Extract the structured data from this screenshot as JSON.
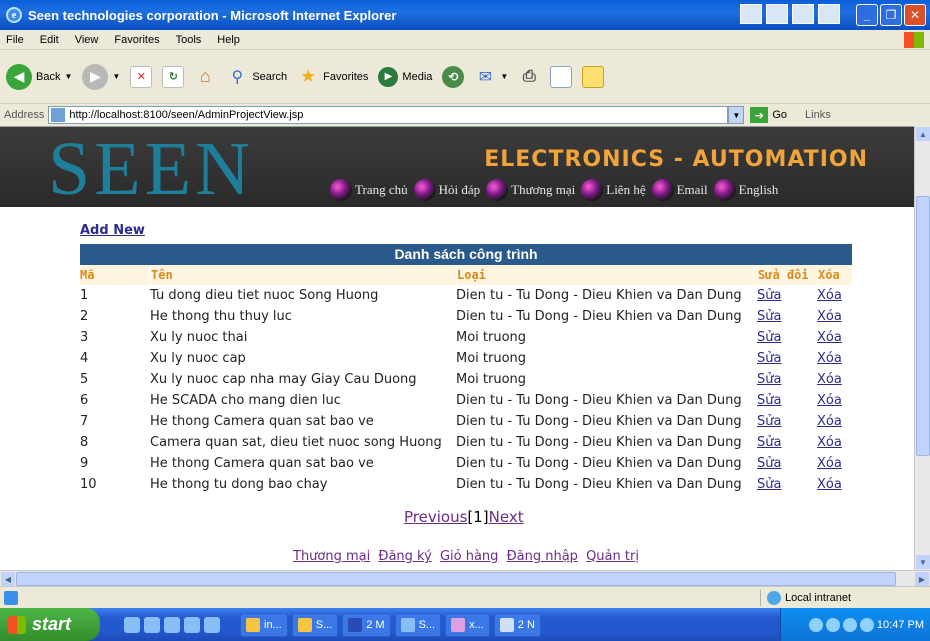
{
  "window": {
    "title": "Seen technologies corporation - Microsoft Internet Explorer"
  },
  "menu": [
    "File",
    "Edit",
    "View",
    "Favorites",
    "Tools",
    "Help"
  ],
  "toolbar": {
    "back": "Back",
    "search": "Search",
    "favorites": "Favorites",
    "media": "Media"
  },
  "address": {
    "label": "Address",
    "url": "http://localhost:8100/seen/AdminProjectView.jsp",
    "go": "Go",
    "links": "Links"
  },
  "banner": {
    "logo": "SEEN",
    "slogan": "ELECTRONICS - AUTOMATION",
    "nav": [
      "Trang chủ",
      "Hỏi đáp",
      "Thương mại",
      "Liên hệ",
      "Email",
      "English"
    ]
  },
  "content": {
    "add_new": "Add New",
    "table_title": "Danh sách công trình",
    "headers": {
      "id": "Mã",
      "name": "Tên",
      "type": "Loại",
      "edit": "Sửa đổi",
      "delete": "Xóa"
    },
    "rows": [
      {
        "id": "1",
        "name": "Tu dong dieu tiet nuoc Song Huong",
        "type": "Dien tu - Tu Dong - Dieu Khien va Dan Dung",
        "edit": "Sửa",
        "delete": "Xóa"
      },
      {
        "id": "2",
        "name": "He thong thu thuy luc",
        "type": "Dien tu - Tu Dong - Dieu Khien va Dan Dung",
        "edit": "Sửa",
        "delete": "Xóa"
      },
      {
        "id": "3",
        "name": "Xu ly nuoc thai",
        "type": "Moi truong",
        "edit": "Sửa",
        "delete": "Xóa"
      },
      {
        "id": "4",
        "name": "Xu ly nuoc cap",
        "type": "Moi truong",
        "edit": "Sửa",
        "delete": "Xóa"
      },
      {
        "id": "5",
        "name": "Xu ly nuoc cap nha may Giay Cau Duong",
        "type": "Moi truong",
        "edit": "Sửa",
        "delete": "Xóa"
      },
      {
        "id": "6",
        "name": "He SCADA cho mang dien luc",
        "type": "Dien tu - Tu Dong - Dieu Khien va Dan Dung",
        "edit": "Sửa",
        "delete": "Xóa"
      },
      {
        "id": "7",
        "name": "He thong Camera quan sat bao ve",
        "type": "Dien tu - Tu Dong - Dieu Khien va Dan Dung",
        "edit": "Sửa",
        "delete": "Xóa"
      },
      {
        "id": "8",
        "name": "Camera quan sat, dieu tiet nuoc song Huong",
        "type": "Dien tu - Tu Dong - Dieu Khien va Dan Dung",
        "edit": "Sửa",
        "delete": "Xóa"
      },
      {
        "id": "9",
        "name": "He thong Camera quan sat bao ve",
        "type": "Dien tu - Tu Dong - Dieu Khien va Dan Dung",
        "edit": "Sửa",
        "delete": "Xóa"
      },
      {
        "id": "10",
        "name": "He thong tu dong bao chay",
        "type": "Dien tu - Tu Dong - Dieu Khien va Dan Dung",
        "edit": "Sửa",
        "delete": "Xóa"
      }
    ],
    "pager": {
      "previous": "Previous",
      "current": "[1]",
      "next": "Next"
    },
    "footer_links": [
      "Thương mại",
      "Đăng ký",
      "Giỏ hàng",
      "Đăng nhập",
      "Quản trị"
    ]
  },
  "status": {
    "zone": "Local intranet"
  },
  "taskbar": {
    "start": "start",
    "tasks": [
      "in...",
      "S...",
      "2 M",
      "S...",
      "x...",
      "2 N"
    ],
    "clock": "10:47 PM"
  }
}
